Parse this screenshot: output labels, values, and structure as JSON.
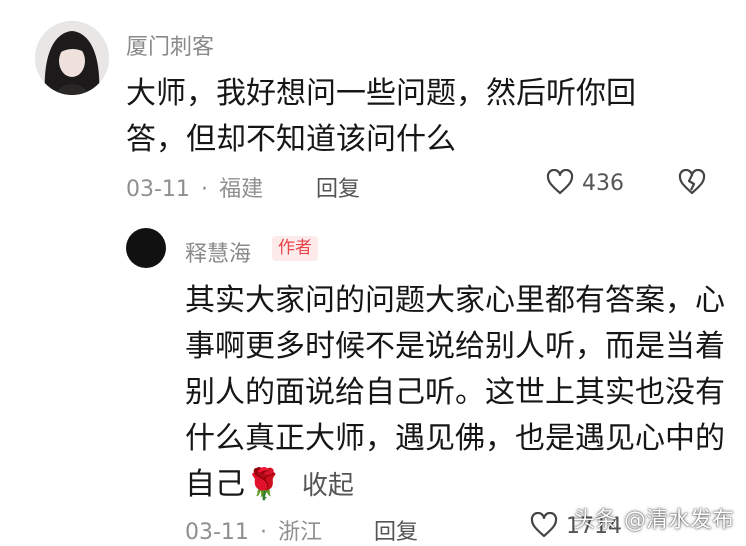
{
  "comment": {
    "username": "厦门刺客",
    "text": "大师，我好想问一些问题，然后听你回答，但却不知道该问什么",
    "date": "03-11",
    "location": "福建",
    "reply_label": "回复",
    "like_count": "436"
  },
  "reply": {
    "username": "释慧海",
    "badge": "作者",
    "text": "其实大家问的问题大家心里都有答案，心事啊更多时候不是说给别人听，而是当着别人的面说给自己听。这世上其实也没有什么真正大师，遇见佛，也是遇见心中的自己",
    "emoji": "🌹",
    "collapse_label": "收起",
    "date": "03-11",
    "location": "浙江",
    "reply_label": "回复",
    "like_count": "1714"
  },
  "meta_separator": "·",
  "watermark": "头条 @清水发布",
  "colors": {
    "author_badge_text": "#e8464c",
    "author_badge_bg": "#fdeaea",
    "meta_gray": "#8f8f8f",
    "text_dark": "#161616"
  },
  "icons": {
    "like": "heart-outline-icon",
    "dislike": "broken-heart-icon"
  }
}
